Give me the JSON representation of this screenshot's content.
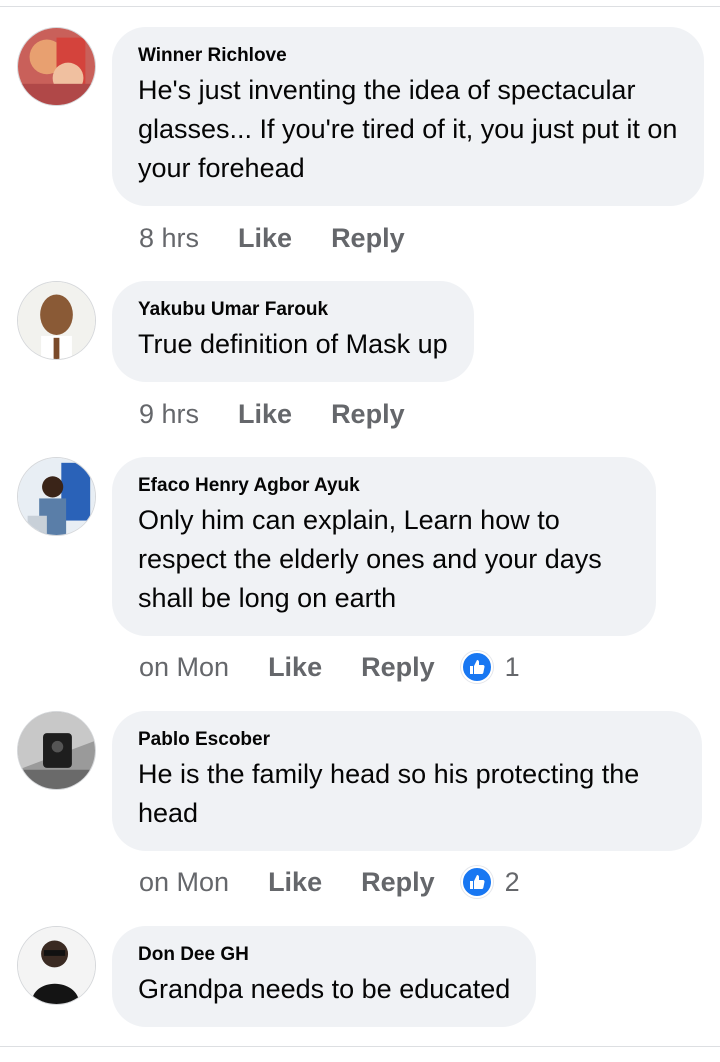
{
  "comments": [
    {
      "author": "Winner Richlove",
      "text": "He's just inventing the idea of spectacular glasses... If you're tired of it, you just put it on your forehead",
      "time": "8 hrs",
      "like_label": "Like",
      "reply_label": "Reply",
      "reactions": null,
      "avatar_icon": "avatar-photo"
    },
    {
      "author": "Yakubu Umar Farouk",
      "text": "True definition of Mask up",
      "time": "9 hrs",
      "like_label": "Like",
      "reply_label": "Reply",
      "reactions": null,
      "avatar_icon": "avatar-photo"
    },
    {
      "author": "Efaco Henry Agbor Ayuk",
      "text": "Only him can explain, Learn how to respect the elderly ones and your days shall be long on earth",
      "time": "on Mon",
      "like_label": "Like",
      "reply_label": "Reply",
      "reactions": "1",
      "avatar_icon": "avatar-photo"
    },
    {
      "author": "Pablo Escober",
      "text": "He is the family head so his protecting the head",
      "time": "on Mon",
      "like_label": "Like",
      "reply_label": "Reply",
      "reactions": "2",
      "avatar_icon": "avatar-photo"
    },
    {
      "author": "Don Dee GH",
      "text": "Grandpa needs to be educated",
      "time": "",
      "like_label": "",
      "reply_label": "",
      "reactions": null,
      "avatar_icon": "avatar-photo"
    }
  ],
  "colors": {
    "bubble": "#f0f2f5",
    "meta_text": "#65676b",
    "like_blue": "#1877f2"
  }
}
